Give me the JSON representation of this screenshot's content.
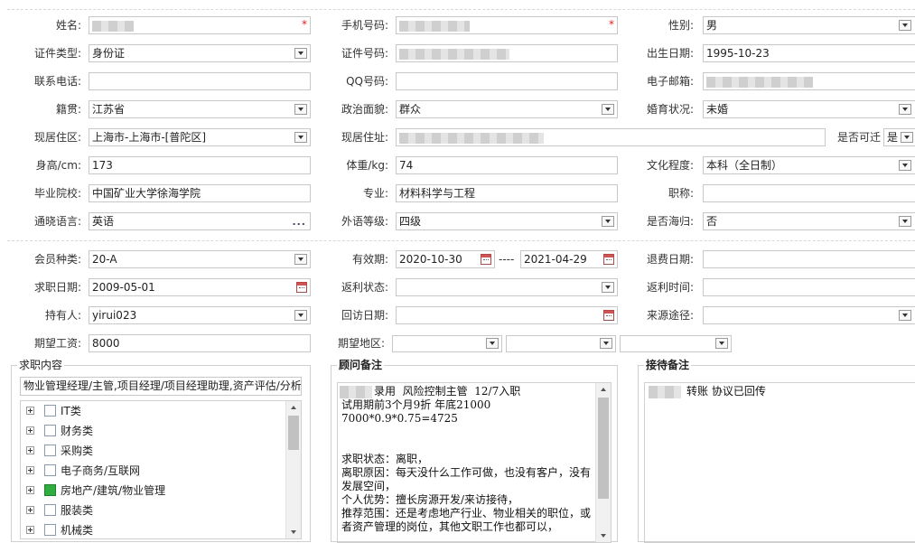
{
  "profile": {
    "name": {
      "label": "姓名:",
      "required": "*"
    },
    "phone": {
      "label": "手机号码:",
      "required": "*"
    },
    "gender": {
      "label": "性别:",
      "value": "男"
    },
    "id_type": {
      "label": "证件类型:",
      "value": "身份证"
    },
    "id_number": {
      "label": "证件号码:"
    },
    "birth_date": {
      "label": "出生日期:",
      "value": "1995-10-23"
    },
    "tel": {
      "label": "联系电话:",
      "value": ""
    },
    "qq": {
      "label": "QQ号码:",
      "value": ""
    },
    "email": {
      "label": "电子邮箱:"
    },
    "native": {
      "label": "籍贯:",
      "value": "江苏省"
    },
    "politics": {
      "label": "政治面貌:",
      "value": "群众"
    },
    "marital": {
      "label": "婚育状况:",
      "value": "未婚"
    },
    "residence_area": {
      "label": "现居住区:",
      "value": "上海市-上海市-[普陀区]"
    },
    "residence_addr": {
      "label": "现居住址:"
    },
    "relocate": {
      "label": "是否可迁",
      "value": "是"
    },
    "height": {
      "label": "身高/cm:",
      "value": "173"
    },
    "weight": {
      "label": "体重/kg:",
      "value": "74"
    },
    "education": {
      "label": "文化程度:",
      "value": "本科（全日制）"
    },
    "school": {
      "label": "毕业院校:",
      "value": "中国矿业大学徐海学院"
    },
    "major": {
      "label": "专业:",
      "value": "材料科学与工程"
    },
    "title": {
      "label": "职称:",
      "value": ""
    },
    "language": {
      "label": "通晓语言:",
      "value": "英语",
      "more": "..."
    },
    "foreign_level": {
      "label": "外语等级:",
      "value": "四级"
    },
    "returnee": {
      "label": "是否海归:",
      "value": "否"
    }
  },
  "membership": {
    "type": {
      "label": "会员种类:",
      "value": "20-A"
    },
    "validity": {
      "label": "有效期:",
      "start": "2020-10-30",
      "sep": "----",
      "end": "2021-04-29"
    },
    "refund_date": {
      "label": "退费日期:",
      "value": ""
    },
    "job_date": {
      "label": "求职日期:",
      "value": "2009-05-01"
    },
    "rebate_status": {
      "label": "返利状态:",
      "value": ""
    },
    "rebate_time": {
      "label": "返利时间:",
      "value": ""
    },
    "holder": {
      "label": "持有人:",
      "value": "yirui023"
    },
    "visit_date": {
      "label": "回访日期:",
      "value": ""
    },
    "source": {
      "label": "来源途径:",
      "value": ""
    },
    "salary": {
      "label": "期望工资:",
      "value": "8000"
    },
    "region": {
      "label": "期望地区:",
      "values": [
        "",
        "",
        ""
      ]
    }
  },
  "job_content": {
    "title": "求职内容",
    "summary": "物业管理经理/主管,项目经理/项目经理助理,资产评估/分析",
    "categories": [
      {
        "label": "IT类",
        "checked": false
      },
      {
        "label": "财务类",
        "checked": false
      },
      {
        "label": "采购类",
        "checked": false
      },
      {
        "label": "电子商务/互联网",
        "checked": false
      },
      {
        "label": "房地产/建筑/物业管理",
        "checked": true
      },
      {
        "label": "服装类",
        "checked": false
      },
      {
        "label": "机械类",
        "checked": false
      }
    ]
  },
  "advisor_notes": {
    "title": "顾问备注",
    "text": "录用  风险控制主管  12/7入职\n试用期前3个月9折 年底21000\n7000*0.9*0.75=4725\n\n\n求职状态：离职，\n离职原因：每天没什么工作可做，也没有客户，没有发展空间，\n个人优势：擅长房源开发/来访接待，\n推荐范围：还是考虑地产行业、物业相关的职位，或者资产管理的岗位，其他文职工作也都可以，"
  },
  "reception_notes": {
    "title": "接待备注",
    "text": "转账 协议已回传"
  }
}
